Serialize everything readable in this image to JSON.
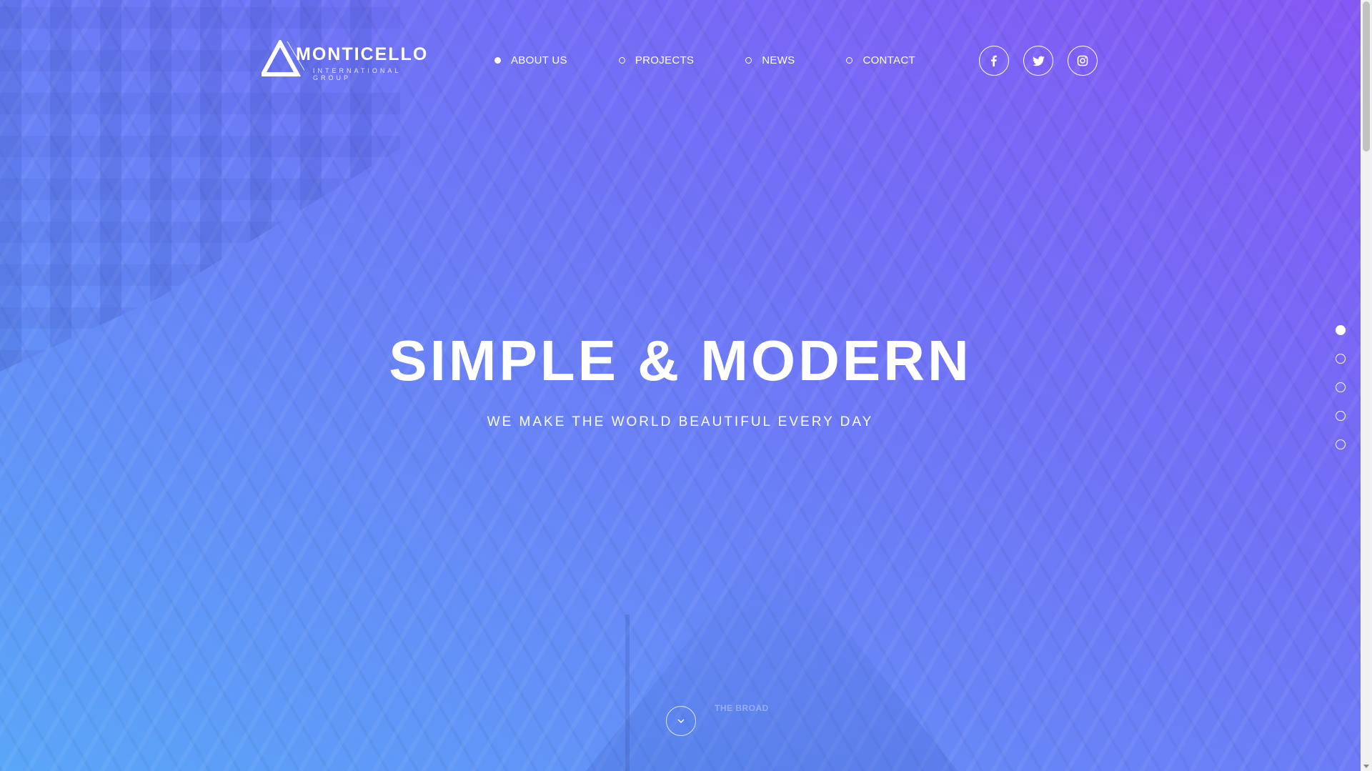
{
  "brand": {
    "name": "MONTICELLO",
    "subtitle": "INTERNATIONAL GROUP"
  },
  "nav": {
    "items": [
      {
        "label": "ABOUT US",
        "active": true
      },
      {
        "label": "PROJECTS",
        "active": false
      },
      {
        "label": "NEWS",
        "active": false
      },
      {
        "label": "CONTACT",
        "active": false
      }
    ]
  },
  "social": {
    "icons": [
      "facebook-icon",
      "twitter-icon",
      "instagram-icon"
    ]
  },
  "hero": {
    "title": "SIMPLE & MODERN",
    "subtitle": "WE MAKE THE WORLD BEAUTIFUL EVERY DAY",
    "background_sign": "THE BROAD"
  },
  "pager": {
    "count": 5,
    "active_index": 0
  },
  "colors": {
    "gradient_top": "#8557f4",
    "gradient_bottom": "#5aa6f8",
    "text": "#ffffff"
  }
}
